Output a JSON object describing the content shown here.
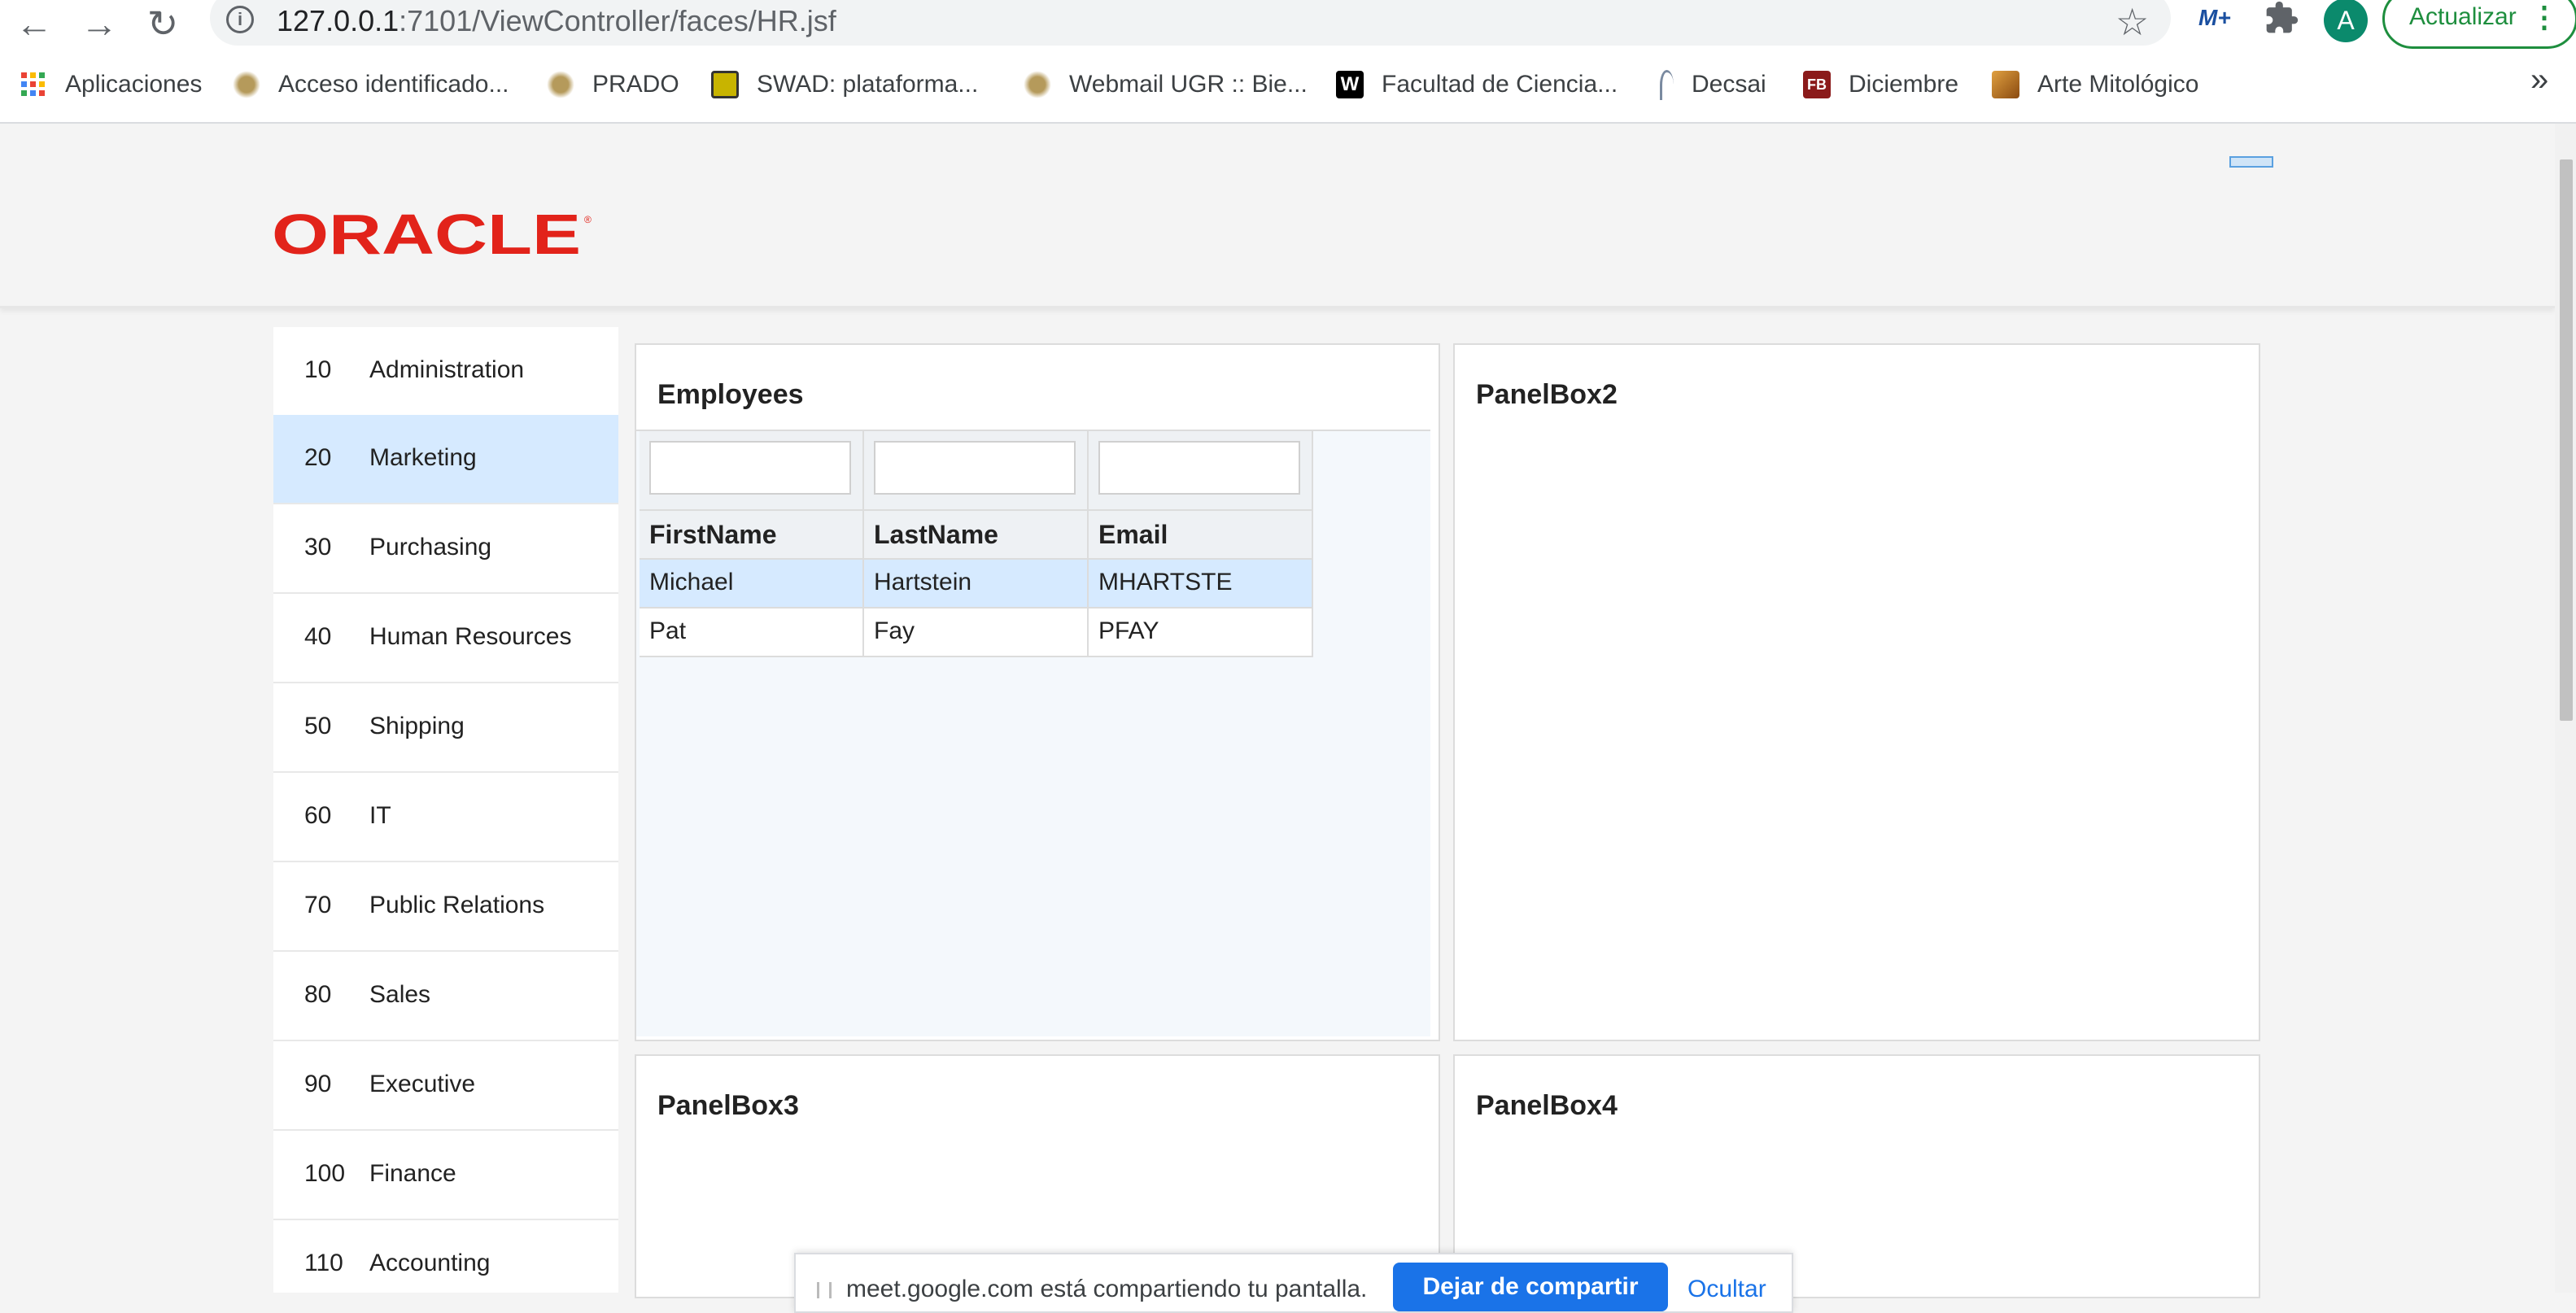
{
  "browser": {
    "url_host": "127.0.0.1",
    "url_path": ":7101/ViewController/faces/HR.jsf",
    "avatar_letter": "A",
    "update_label": "Actualizar",
    "more_glyph": "⋮",
    "extension_badge": "M+",
    "bookmarks_more": "»",
    "bookmarks": [
      {
        "label": "Aplicaciones",
        "icon": "apps-grid-icon",
        "color": "#ea4335"
      },
      {
        "label": "Acceso identificado...",
        "icon": "ugr-crest-icon",
        "color": "#8a6d3b"
      },
      {
        "label": "PRADO",
        "icon": "ugr-crest-icon",
        "color": "#8a6d3b"
      },
      {
        "label": "SWAD: plataforma...",
        "icon": "swad-icon",
        "color": "#c8b400"
      },
      {
        "label": "Webmail UGR :: Bie...",
        "icon": "ugr-crest-icon",
        "color": "#8a6d3b"
      },
      {
        "label": "Facultad de Ciencia...",
        "icon": "w-logo-icon",
        "color": "#000000"
      },
      {
        "label": "Decsai",
        "icon": "decsai-icon",
        "color": "#7a8aa0"
      },
      {
        "label": "Diciembre",
        "icon": "fb-icon",
        "color": "#8b1a1a"
      },
      {
        "label": "Arte Mitológico",
        "icon": "art-thumbnail-icon",
        "color": "#c9822b"
      }
    ]
  },
  "app": {
    "logo_text": "ORACLE",
    "brand_color": "#e2231a",
    "departments": [
      {
        "id": "10",
        "name": "Administration"
      },
      {
        "id": "20",
        "name": "Marketing",
        "selected": true
      },
      {
        "id": "30",
        "name": "Purchasing"
      },
      {
        "id": "40",
        "name": "Human Resources"
      },
      {
        "id": "50",
        "name": "Shipping"
      },
      {
        "id": "60",
        "name": "IT"
      },
      {
        "id": "70",
        "name": "Public Relations"
      },
      {
        "id": "80",
        "name": "Sales"
      },
      {
        "id": "90",
        "name": "Executive"
      },
      {
        "id": "100",
        "name": "Finance"
      },
      {
        "id": "110",
        "name": "Accounting"
      }
    ],
    "employees_panel": {
      "title": "Employees",
      "columns": [
        "FirstName",
        "LastName",
        "Email"
      ],
      "rows": [
        {
          "first": "Michael",
          "last": "Hartstein",
          "email": "MHARTSTE",
          "selected": true
        },
        {
          "first": "Pat",
          "last": "Fay",
          "email": "PFAY"
        }
      ]
    },
    "panel2_title": "PanelBox2",
    "panel3_title": "PanelBox3",
    "panel4_title": "PanelBox4"
  },
  "share_bar": {
    "text": "meet.google.com está compartiendo tu pantalla.",
    "stop_label": "Dejar de compartir",
    "hide_label": "Ocultar"
  }
}
